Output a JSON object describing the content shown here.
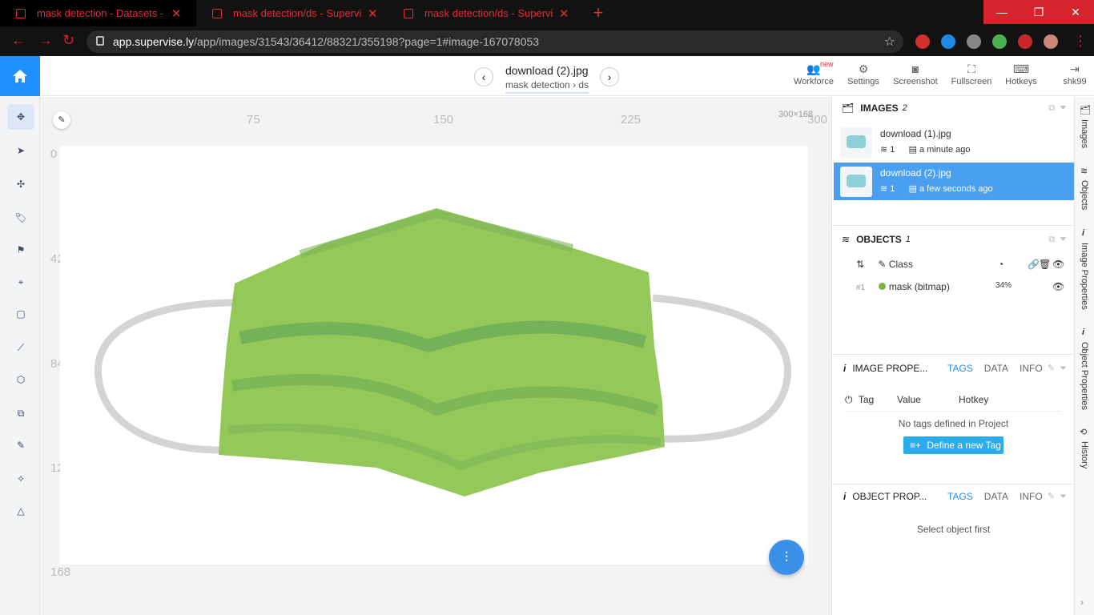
{
  "browser": {
    "tabs": [
      {
        "title": "mask detection - Datasets - Supervisely",
        "active": true
      },
      {
        "title": "mask detection/ds - Supervisely",
        "active": false
      },
      {
        "title": "mask detection/ds - Supervisely",
        "active": false
      }
    ],
    "url_domain": "app.supervise.ly",
    "url_path": "/app/images/31543/36412/88321/355198?page=1#image-167078053"
  },
  "header": {
    "image_title": "download (2).jpg",
    "breadcrumb_project": "mask detection",
    "breadcrumb_sep": "›",
    "breadcrumb_dataset": "ds",
    "actions": [
      {
        "label": "Workforce",
        "icon": "users-icon"
      },
      {
        "label": "Settings",
        "icon": "gear-icon"
      },
      {
        "label": "Screenshot",
        "icon": "camera-icon"
      },
      {
        "label": "Fullscreen",
        "icon": "fullscreen-icon"
      },
      {
        "label": "Hotkeys",
        "icon": "keyboard-icon"
      },
      {
        "label": "shk99",
        "icon": "logout-icon"
      }
    ],
    "new_badge": "new"
  },
  "canvas": {
    "ruler_x": [
      "75",
      "150",
      "225",
      "300"
    ],
    "ruler_y": [
      "0",
      "42",
      "84",
      "12",
      "168"
    ],
    "dimensions": "300×168",
    "mask_color": "#8bc34a"
  },
  "images_panel": {
    "title": "IMAGES",
    "count": "2",
    "items": [
      {
        "name": "download (1).jpg",
        "objects": "1",
        "time": "a minute ago"
      },
      {
        "name": "download (2).jpg",
        "objects": "1",
        "time": "a few seconds ago"
      }
    ]
  },
  "objects_panel": {
    "title": "OBJECTS",
    "count": "1",
    "class_header": "Class",
    "items": [
      {
        "index": "#1",
        "name": "mask (bitmap)",
        "area": "34%",
        "color": "#7cb342"
      }
    ]
  },
  "image_props": {
    "title": "IMAGE PROPE...",
    "tabs": [
      "TAGS",
      "DATA",
      "INFO"
    ],
    "columns": [
      "Tag",
      "Value",
      "Hotkey"
    ],
    "empty_text": "No tags defined in Project",
    "button": "Define a new Tag"
  },
  "object_props": {
    "title": "OBJECT PROP...",
    "tabs": [
      "TAGS",
      "DATA",
      "INFO"
    ],
    "empty_text": "Select object first"
  },
  "side_tabs": [
    "Images",
    "Objects",
    "Image Properties",
    "Object Properties",
    "History"
  ]
}
